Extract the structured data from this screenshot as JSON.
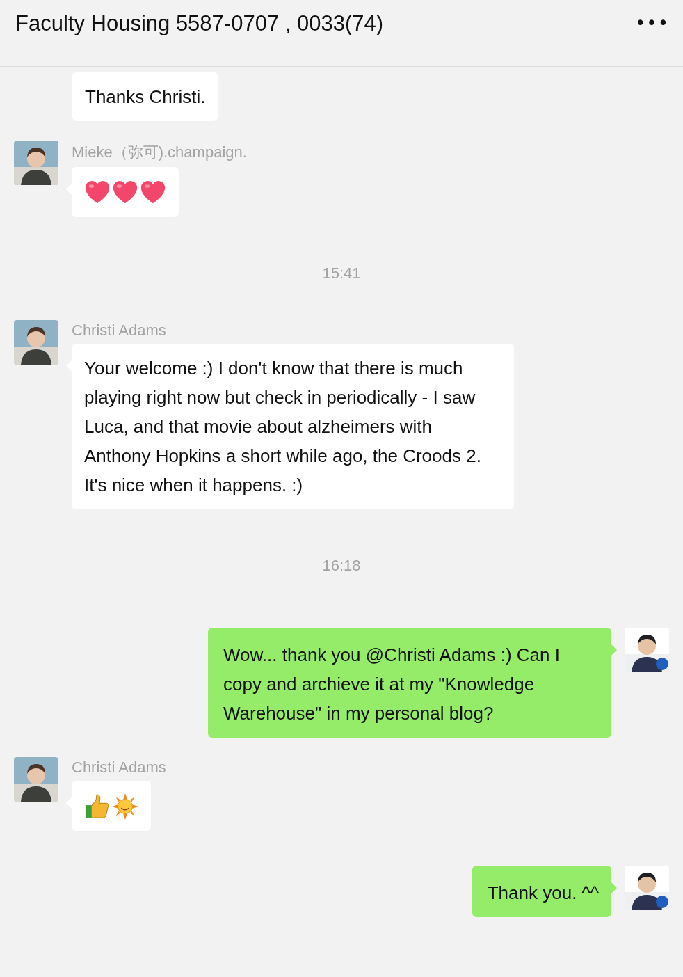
{
  "header": {
    "title": "Faculty Housing 5587-0707 , 0033(74)",
    "menu": "•••"
  },
  "messages": [
    {
      "kind": "text",
      "outgoing": false,
      "text": "Thanks Christi."
    },
    {
      "kind": "emoji",
      "outgoing": false,
      "sender": "Mieke（弥可).champaign.",
      "avatar": {
        "kind": "picture"
      },
      "emoji": [
        {
          "kind": "heart"
        },
        {
          "kind": "heart"
        },
        {
          "kind": "heart"
        }
      ]
    },
    {
      "kind": "time",
      "text": "15:41"
    },
    {
      "kind": "text",
      "outgoing": false,
      "sender": "Christi Adams",
      "avatar": {
        "kind": "picture"
      },
      "text": "Your welcome :) I don't know that there is much playing right now but check in periodically - I saw Luca, and that movie about alzheimers with Anthony Hopkins a short while ago, the Croods 2. It's nice when it happens. :)"
    },
    {
      "kind": "time",
      "text": "16:18"
    },
    {
      "kind": "text",
      "outgoing": true,
      "avatar": {
        "kind": "picture"
      },
      "text": "Wow... thank you @Christi Adams  :) Can I copy and archieve it at my \"Knowledge Warehouse\" in my personal blog?"
    },
    {
      "kind": "emoji",
      "outgoing": false,
      "sender": "Christi Adams",
      "avatar": {
        "kind": "picture"
      },
      "emoji": [
        {
          "kind": "thumbs-up"
        },
        {
          "kind": "sun"
        }
      ]
    },
    {
      "kind": "text",
      "outgoing": true,
      "avatar": {
        "kind": "picture"
      },
      "text": "Thank you. ^^"
    }
  ]
}
